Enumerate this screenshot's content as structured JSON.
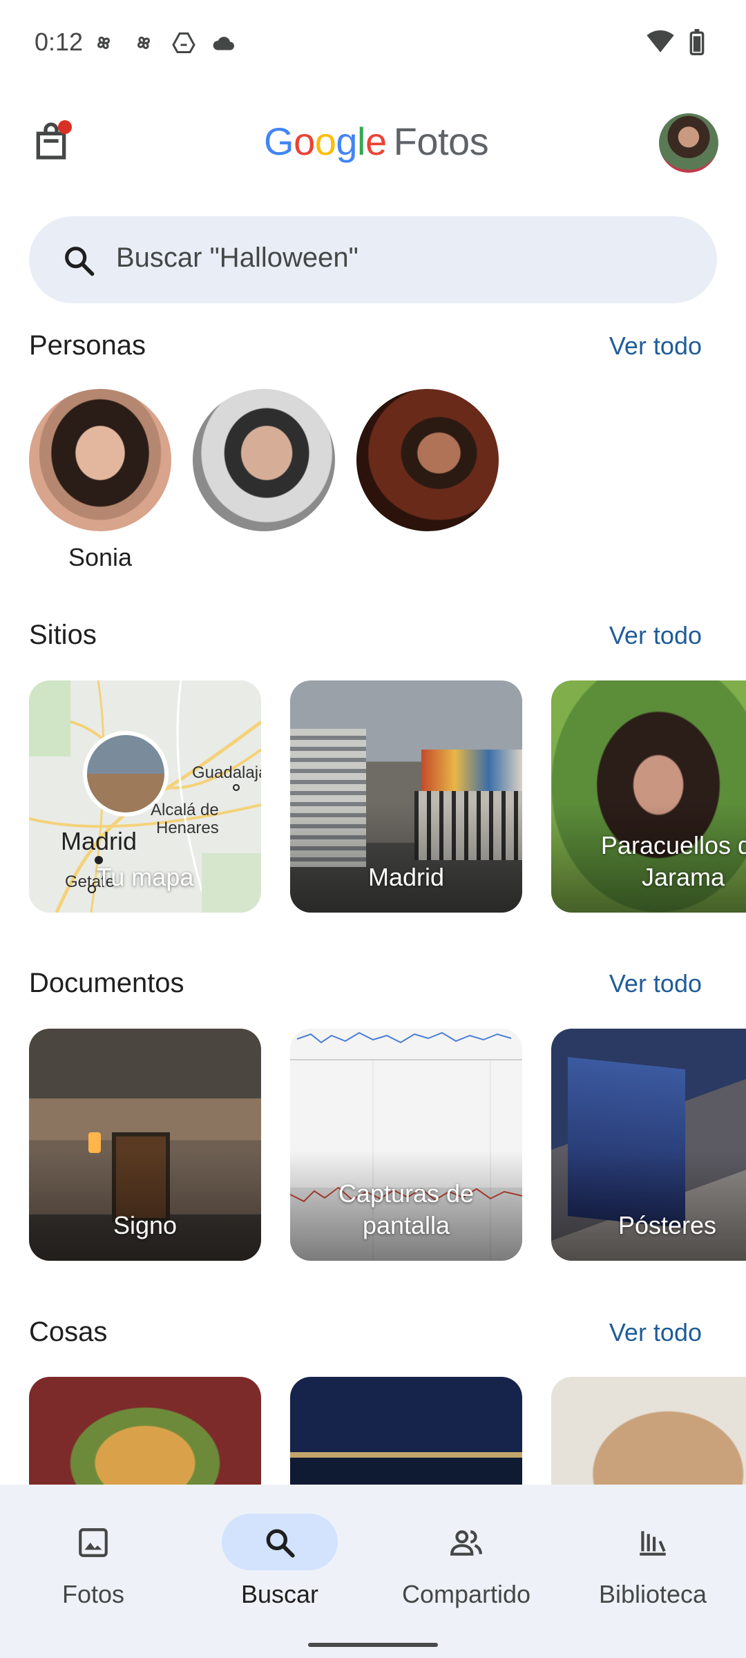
{
  "status_bar": {
    "time": "0:12"
  },
  "header": {
    "logo_google": [
      "G",
      "o",
      "o",
      "g",
      "l",
      "e"
    ],
    "logo_colors": [
      "#4285F4",
      "#EA4335",
      "#FBBC05",
      "#4285F4",
      "#34A853",
      "#EA4335"
    ],
    "logo_fotos": "Fotos"
  },
  "search": {
    "placeholder": "Buscar \"Halloween\""
  },
  "sections": {
    "personas": {
      "title": "Personas",
      "see_all": "Ver todo",
      "people": [
        "Sonia"
      ]
    },
    "sitios": {
      "title": "Sitios",
      "see_all": "Ver todo",
      "items": [
        "Tu mapa",
        "Madrid",
        "Paracuellos de Jarama"
      ]
    },
    "documentos": {
      "title": "Documentos",
      "see_all": "Ver todo",
      "items": [
        "Signo",
        "Capturas de pantalla",
        "Pósteres"
      ]
    },
    "cosas": {
      "title": "Cosas",
      "see_all": "Ver todo"
    }
  },
  "map_labels": {
    "madrid": "Madrid",
    "guadalajara": "Guadalaja",
    "alcala": "Alcalá de",
    "henares": "Henares",
    "getafe": "Getafe"
  },
  "nav": {
    "items": [
      "Fotos",
      "Buscar",
      "Compartido",
      "Biblioteca"
    ],
    "active": "Buscar"
  },
  "colors": {
    "accent_link": "#1f5c99",
    "nav_active_pill": "#d3e3fd",
    "search_bg": "#e9eef6"
  }
}
